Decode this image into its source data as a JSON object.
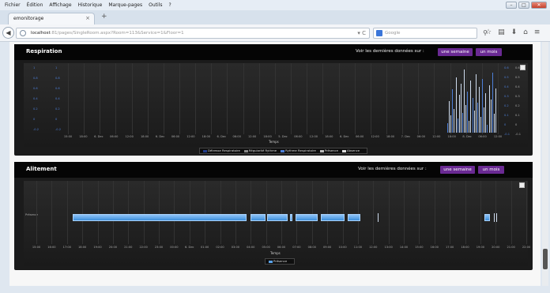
{
  "menu": [
    "Fichier",
    "Édition",
    "Affichage",
    "Historique",
    "Marque-pages",
    "Outils",
    "?"
  ],
  "tab": {
    "title": "emonitorage"
  },
  "address": {
    "host": "localhost",
    "path": ":81/pages/SingleRoom.aspx?Room=113&Service=1&Floor=1",
    "search_placeholder": "Google"
  },
  "panels": {
    "respiration": {
      "title": "Respiration",
      "label": "Voir les dernières données sur :",
      "btn_week": "une semaine",
      "btn_month": "un mois",
      "xlabel": "Temps",
      "legend": [
        "Détresse Respiratoire",
        "Régularité Rythme",
        "Rythme Respiratoire",
        "Présence",
        "Absence"
      ]
    },
    "alitement": {
      "title": "Alitement",
      "label": "Voir les dernières données sur :",
      "btn_week": "une semaine",
      "btn_month": "un mois",
      "xlabel": "Temps",
      "ylabel_row": "Présence",
      "legend": [
        "Présence"
      ]
    }
  },
  "chart_data": [
    {
      "type": "line",
      "title": "Respiration",
      "xlabel": "Temps",
      "x_ticks": [
        "15:00",
        "18:00",
        "6. Dec",
        "06:00",
        "12:00",
        "18:00",
        "6. Dec",
        "06:00",
        "12:00",
        "18:00",
        "6. Dec",
        "06:00",
        "12:00",
        "18:00",
        "5. Dec",
        "06:00",
        "12:00",
        "18:00",
        "6. Dec",
        "06:00",
        "12:00",
        "18:00",
        "7. Dec",
        "06:00",
        "12:00",
        "18:00",
        "8. Dec",
        "06:00",
        "12:00"
      ],
      "series": [
        {
          "name": "Détresse Respiratoire"
        },
        {
          "name": "Régularité Rythme"
        },
        {
          "name": "Rythme Respiratoire"
        },
        {
          "name": "Présence"
        },
        {
          "name": "Absence"
        }
      ],
      "left_ticks": [
        "1",
        "0.8",
        "0.6",
        "0.4",
        "0.2",
        "0",
        "-0.2"
      ],
      "right_ticks": [
        "0.6",
        "0.5",
        "0.4",
        "0.3",
        "0.2",
        "0.1",
        "0",
        "-0.1"
      ]
    },
    {
      "type": "bar",
      "title": "Alitement",
      "xlabel": "Temps",
      "categories": [
        "Présence"
      ],
      "x_ticks": [
        "15:00",
        "16:00",
        "17:00",
        "18:00",
        "19:00",
        "20:00",
        "21:00",
        "22:00",
        "23:00",
        "00:00",
        "6. Dec",
        "01:00",
        "02:00",
        "03:00",
        "04:00",
        "05:00",
        "06:00",
        "07:00",
        "08:00",
        "09:00",
        "10:00",
        "11:00",
        "12:00",
        "13:00",
        "14:00",
        "15:00",
        "16:00",
        "17:00",
        "18:00",
        "19:00",
        "20:00",
        "21:00",
        "22:00"
      ],
      "series": [
        {
          "name": "Présence"
        }
      ]
    }
  ],
  "colors": {
    "accent_button": "#6a2a93",
    "presence_bar": "#5aa3ea",
    "panel_bg": "#1b1b1b"
  }
}
